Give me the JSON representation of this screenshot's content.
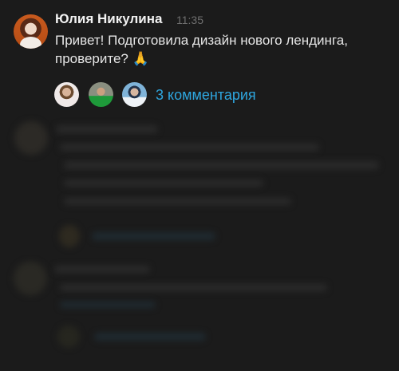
{
  "message": {
    "author": "Юлия Никулина",
    "time": "11:35",
    "text": "Привет! Подготовила дизайн нового лендинга, проверите? 🙏",
    "thread": {
      "participants": [
        "participant-1",
        "participant-2",
        "participant-3"
      ],
      "comments_label": "3 комментария"
    }
  },
  "colors": {
    "background": "#1b1b1b",
    "link": "#2ea6df",
    "time": "#6f6f6f"
  }
}
